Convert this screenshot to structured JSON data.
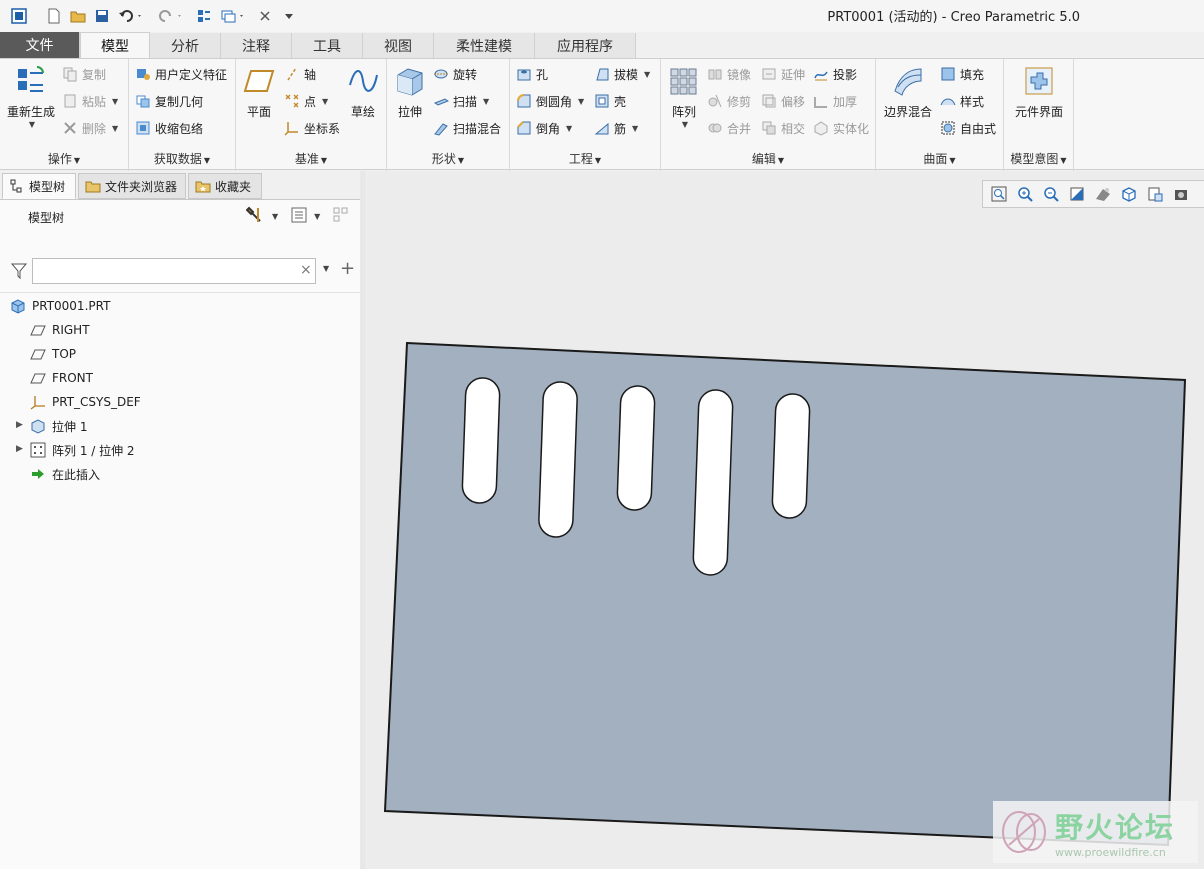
{
  "window": {
    "title": "PRT0001 (活动的) - Creo Parametric 5.0"
  },
  "tabs": [
    "文件",
    "模型",
    "分析",
    "注释",
    "工具",
    "视图",
    "柔性建模",
    "应用程序"
  ],
  "ribbon": {
    "operations": {
      "regenerate": "重新生成",
      "copy": "复制",
      "paste": "粘贴",
      "delete": "删除",
      "label": "操作"
    },
    "get_data": {
      "udf": "用户定义特征",
      "copy_geom": "复制几何",
      "shrinkwrap": "收缩包络",
      "label": "获取数据"
    },
    "datum": {
      "plane": "平面",
      "axis": "轴",
      "point": "点",
      "csys": "坐标系",
      "sketch": "草绘",
      "label": "基准"
    },
    "shapes": {
      "extrude": "拉伸",
      "revolve": "旋转",
      "sweep": "扫描",
      "swept_blend": "扫描混合",
      "label": "形状"
    },
    "engineering": {
      "hole": "孔",
      "draft": "拔模",
      "round": "倒圆角",
      "shell": "壳",
      "chamfer": "倒角",
      "rib": "筋",
      "label": "工程"
    },
    "editing": {
      "pattern": "阵列",
      "mirror": "镜像",
      "extend": "延伸",
      "project": "投影",
      "trim": "修剪",
      "offset": "偏移",
      "thicken": "加厚",
      "merge": "合并",
      "intersect": "相交",
      "solidify": "实体化",
      "label": "编辑"
    },
    "surfaces": {
      "boundary_blend": "边界混合",
      "fill": "填充",
      "style": "样式",
      "freestyle": "自由式",
      "label": "曲面"
    },
    "model_intent": {
      "component_interface": "元件界面",
      "label": "模型意图"
    }
  },
  "left_panel": {
    "tabs": [
      "模型树",
      "文件夹浏览器",
      "收藏夹"
    ],
    "tree_title": "模型树",
    "search": {
      "value": ""
    },
    "items": [
      {
        "label": "PRT0001.PRT",
        "icon": "part-icon"
      },
      {
        "label": "RIGHT",
        "icon": "datum-plane-icon"
      },
      {
        "label": "TOP",
        "icon": "datum-plane-icon"
      },
      {
        "label": "FRONT",
        "icon": "datum-plane-icon"
      },
      {
        "label": "PRT_CSYS_DEF",
        "icon": "csys-icon"
      },
      {
        "label": "拉伸 1",
        "icon": "extrude-icon"
      },
      {
        "label": "阵列 1 / 拉伸 2",
        "icon": "pattern-icon"
      },
      {
        "label": "在此插入",
        "icon": "insert-arrow-icon"
      }
    ]
  },
  "graphics": {
    "part_color": "#a3b0c0",
    "background": "#ececec",
    "slot_count": 5
  },
  "watermark": {
    "title": "野火论坛",
    "url": "www.proewildfire.cn"
  }
}
